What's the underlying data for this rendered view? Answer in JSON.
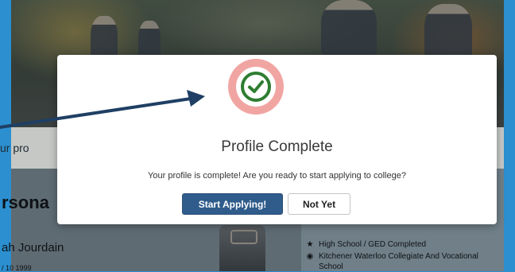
{
  "background_page": {
    "strip_text": "ur pro",
    "section_heading": "rsona",
    "name": "ah Jourdain",
    "date": "/ 10 1999",
    "facts": [
      {
        "icon": "star-icon",
        "text": "High School / GED Completed"
      },
      {
        "icon": "school-icon",
        "text": "Kitchener Waterloo Collegiate And Vocational"
      },
      {
        "icon": "",
        "text": "School"
      }
    ]
  },
  "modal": {
    "title": "Profile Complete",
    "message": "Your profile is complete! Are you ready to start applying to college?",
    "primary_button": "Start Applying!",
    "secondary_button": "Not Yet",
    "icon": "checkmark-circle-icon"
  },
  "colors": {
    "primary_button": "#2f5c8b",
    "check_green": "#2e7d32",
    "check_ring": "#f1a5a2",
    "arrow": "#1f3f64",
    "frame_border": "#2b8fd0"
  }
}
